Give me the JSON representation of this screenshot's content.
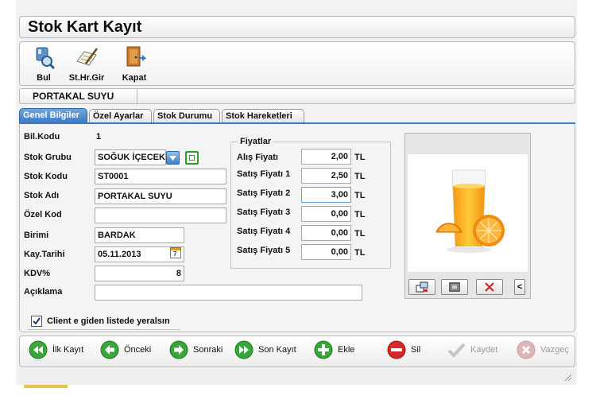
{
  "window": {
    "title": "Stok Kart Kayıt"
  },
  "toolbar": {
    "buttons": [
      {
        "label": "Bul",
        "icon": "binoculars-icon"
      },
      {
        "label": "St.Hr.Gir",
        "icon": "notepad-pen-icon"
      },
      {
        "label": "Kapat",
        "icon": "exit-door-icon"
      }
    ]
  },
  "record": {
    "name": "PORTAKAL SUYU"
  },
  "tabs": [
    {
      "label": "Genel Bilgiler",
      "active": true
    },
    {
      "label": "Özel Ayarlar",
      "active": false
    },
    {
      "label": "Stok Durumu",
      "active": false
    },
    {
      "label": "Stok Hareketleri",
      "active": false
    }
  ],
  "form": {
    "bil_kodu": {
      "label": "Bil.Kodu",
      "value": "1"
    },
    "stok_grubu": {
      "label": "Stok Grubu",
      "value": "SOĞUK İÇECEKL"
    },
    "stok_kodu": {
      "label": "Stok Kodu",
      "value": "ST0001"
    },
    "stok_adi": {
      "label": "Stok Adı",
      "value": "PORTAKAL SUYU"
    },
    "ozel_kod": {
      "label": "Özel Kod",
      "value": ""
    },
    "birimi": {
      "label": "Birimi",
      "value": "BARDAK"
    },
    "kay_tarihi": {
      "label": "Kay.Tarihi",
      "value": "05.11.2013",
      "calendar_glyph": "7"
    },
    "kdv": {
      "label": "KDV%",
      "value": "8"
    },
    "aciklama": {
      "label": "Açıklama",
      "value": ""
    }
  },
  "prices": {
    "legend": "Fiyatlar",
    "currency": "TL",
    "rows": [
      {
        "label": "Alış Fiyatı",
        "value": "2,00"
      },
      {
        "label": "Satış Fiyatı 1",
        "value": "2,50"
      },
      {
        "label": "Satış Fiyatı 2",
        "value": "3,00"
      },
      {
        "label": "Satış Fiyatı 3",
        "value": "0,00"
      },
      {
        "label": "Satış Fiyatı 4",
        "value": "0,00"
      },
      {
        "label": "Satış Fiyatı 5",
        "value": "0,00"
      }
    ]
  },
  "image_panel": {
    "picture": "orange-juice-glass",
    "buttons": [
      "load-image-icon",
      "view-image-icon",
      "delete-image-icon"
    ],
    "collapse_label": "<"
  },
  "client_checkbox": {
    "label": "Client e giden listede yeralsın",
    "checked": true
  },
  "navigation": {
    "buttons": [
      {
        "label": "İlk Kayıt",
        "icon": "first-record-icon",
        "enabled": true
      },
      {
        "label": "Önceki",
        "icon": "previous-record-icon",
        "enabled": true
      },
      {
        "label": "Sonraki",
        "icon": "next-record-icon",
        "enabled": true
      },
      {
        "label": "Son Kayıt",
        "icon": "last-record-icon",
        "enabled": true
      },
      {
        "label": "Ekle",
        "icon": "add-icon",
        "enabled": true
      },
      {
        "label": "Sil",
        "icon": "delete-icon",
        "enabled": true
      },
      {
        "label": "Kaydet",
        "icon": "save-check-icon",
        "enabled": false
      },
      {
        "label": "Vazgeç",
        "icon": "cancel-icon",
        "enabled": false
      }
    ]
  },
  "colors": {
    "tab_active": "#3b79c2",
    "nav_green": "#3aa53a",
    "delete_red": "#d62828",
    "disabled_gray": "#b8b8b8"
  }
}
